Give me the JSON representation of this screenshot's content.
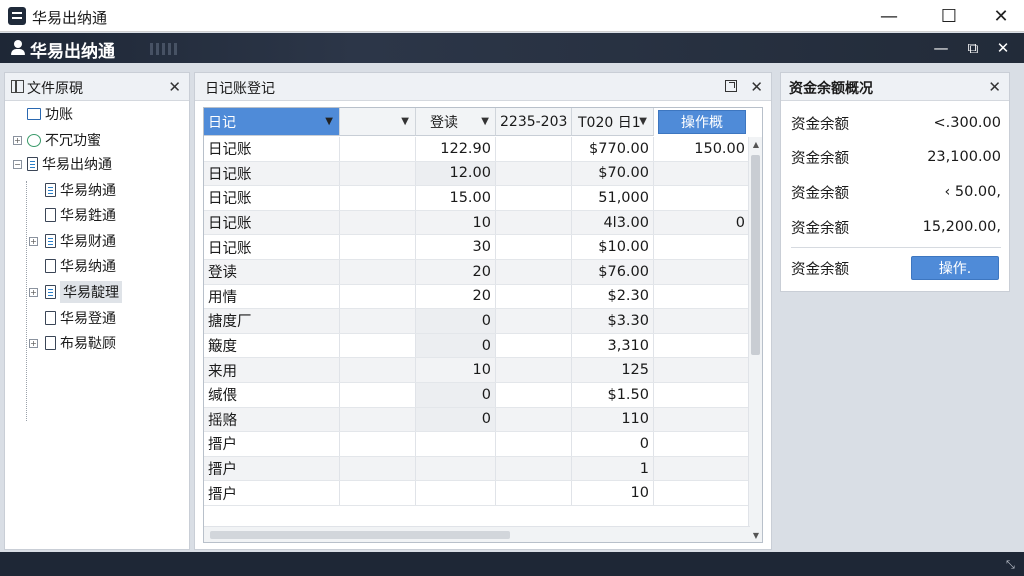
{
  "window": {
    "title": "华易出纳通",
    "controls": {
      "minimize": "—",
      "maximize": "☐",
      "close": "✕"
    }
  },
  "appbar": {
    "title": "华易出纳通",
    "controls": {
      "minimize": "—",
      "restore": "⧉",
      "close": "✕"
    }
  },
  "left_panel": {
    "title": "文件原硯",
    "close": "✕",
    "tree": [
      {
        "label": "功账",
        "icon": "folder-icon",
        "expander": ""
      },
      {
        "label": "不冗功蜜",
        "icon": "sync-icon",
        "expander": "+"
      },
      {
        "label": "华易出纳通",
        "icon": "doc-icon",
        "expander": "−"
      },
      {
        "label": "华易纳通",
        "icon": "doc-icon",
        "expander": ""
      },
      {
        "label": "华易鉎通",
        "icon": "doc-icon",
        "expander": ""
      },
      {
        "label": "华易财通",
        "icon": "doc-icon",
        "expander": "+"
      },
      {
        "label": "华易纳通",
        "icon": "doc-icon",
        "expander": ""
      },
      {
        "label": "华易靛理",
        "icon": "doc-icon",
        "expander": "+"
      },
      {
        "label": "华易登通",
        "icon": "doc-icon",
        "expander": ""
      },
      {
        "label": "布易鞑顾",
        "icon": "doc-icon",
        "expander": "+"
      }
    ]
  },
  "center_panel": {
    "title": "日记账登记",
    "close": "✕",
    "header": {
      "col1": "日记",
      "col2": "",
      "col3": "登读",
      "col4": "2235-203",
      "col5": "T020 日1",
      "action_button": "操作概"
    },
    "rows": [
      {
        "name": "日记账",
        "qty": "122.90",
        "amount": "$770.00",
        "extra": "150.00"
      },
      {
        "name": "日记账",
        "qty": "12.00",
        "amount": "$70.00",
        "extra": ""
      },
      {
        "name": "日记账",
        "qty": "15.00",
        "amount": "51,000",
        "extra": ""
      },
      {
        "name": "日记账",
        "qty": "10",
        "amount": "4l3.00",
        "extra": "0"
      },
      {
        "name": "日记账",
        "qty": "30",
        "amount": "$10.00",
        "extra": ""
      },
      {
        "name": "登读",
        "qty": "20",
        "amount": "$76.00",
        "extra": ""
      },
      {
        "name": "用情",
        "qty": "20",
        "amount": "$2.30",
        "extra": ""
      },
      {
        "name": "搪度厂",
        "qty": "0",
        "amount": "$3.30",
        "extra": ""
      },
      {
        "name": "簸度",
        "qty": "0",
        "amount": "3,310",
        "extra": ""
      },
      {
        "name": "来用",
        "qty": "10",
        "amount": "125",
        "extra": ""
      },
      {
        "name": "缄偎",
        "qty": "0",
        "amount": "$1.50",
        "extra": ""
      },
      {
        "name": "摇赂",
        "qty": "0",
        "amount": "110",
        "extra": ""
      },
      {
        "name": "搢户",
        "qty": "",
        "amount": "0",
        "extra": ""
      },
      {
        "name": "搢户",
        "qty": "",
        "amount": "1",
        "extra": ""
      },
      {
        "name": "搢户",
        "qty": "",
        "amount": "10",
        "extra": ""
      }
    ]
  },
  "right_panel": {
    "title": "资金余额概况",
    "close": "✕",
    "balances": [
      {
        "label": "资金余额",
        "value": "<.300.00"
      },
      {
        "label": "资金余额",
        "value": "23,100.00"
      },
      {
        "label": "资金余额",
        "value": "‹ 50.00,"
      },
      {
        "label": "资金余额",
        "value": "15,200.00,"
      }
    ],
    "footer_label": "资金余额",
    "operate_button": "操作."
  },
  "colors": {
    "accent": "#4f8bd8",
    "header_dark": "#1e2736",
    "panel_bg": "#ffffff"
  }
}
